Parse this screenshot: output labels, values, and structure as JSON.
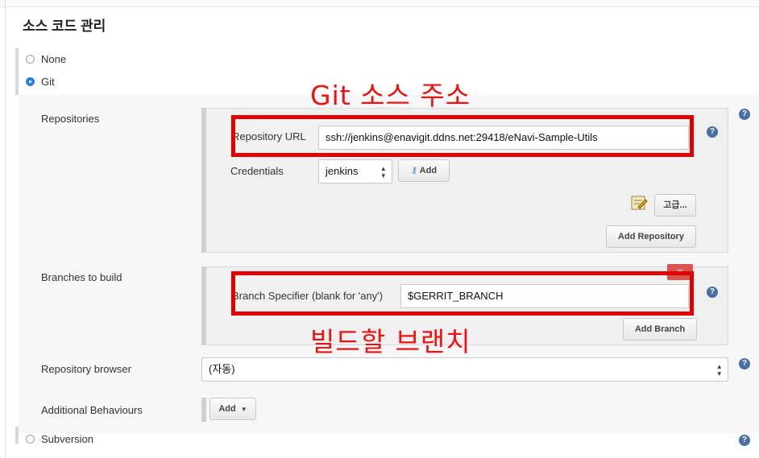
{
  "section": {
    "title": "소스 코드 관리"
  },
  "scm_options": [
    {
      "label": "None",
      "selected": false
    },
    {
      "label": "Git",
      "selected": true
    },
    {
      "label": "Subversion",
      "selected": false
    }
  ],
  "repositories": {
    "label": "Repositories",
    "url_label": "Repository URL",
    "url_value": "ssh://jenkins@enavigit.ddns.net:29418/eNavi-Sample-Utils",
    "credentials_label": "Credentials",
    "credentials_value": "jenkins",
    "add_credentials": "Add",
    "advanced": "고급...",
    "add_repository": "Add Repository"
  },
  "branches": {
    "label": "Branches to build",
    "specifier_label": "Branch Specifier (blank for 'any')",
    "specifier_value": "$GERRIT_BRANCH",
    "delete_symbol": "×",
    "add_branch": "Add Branch"
  },
  "repository_browser": {
    "label": "Repository browser",
    "value": "(자동)"
  },
  "additional_behaviours": {
    "label": "Additional Behaviours",
    "add": "Add"
  },
  "annotations": {
    "git_source": "Git 소스 주소",
    "build_branch": "빌드할 브랜치"
  },
  "help_symbol": "?",
  "colors": {
    "annotation": "#e00000",
    "radio_selected": "#2f7de1",
    "help_icon": "#4a6fa5"
  }
}
